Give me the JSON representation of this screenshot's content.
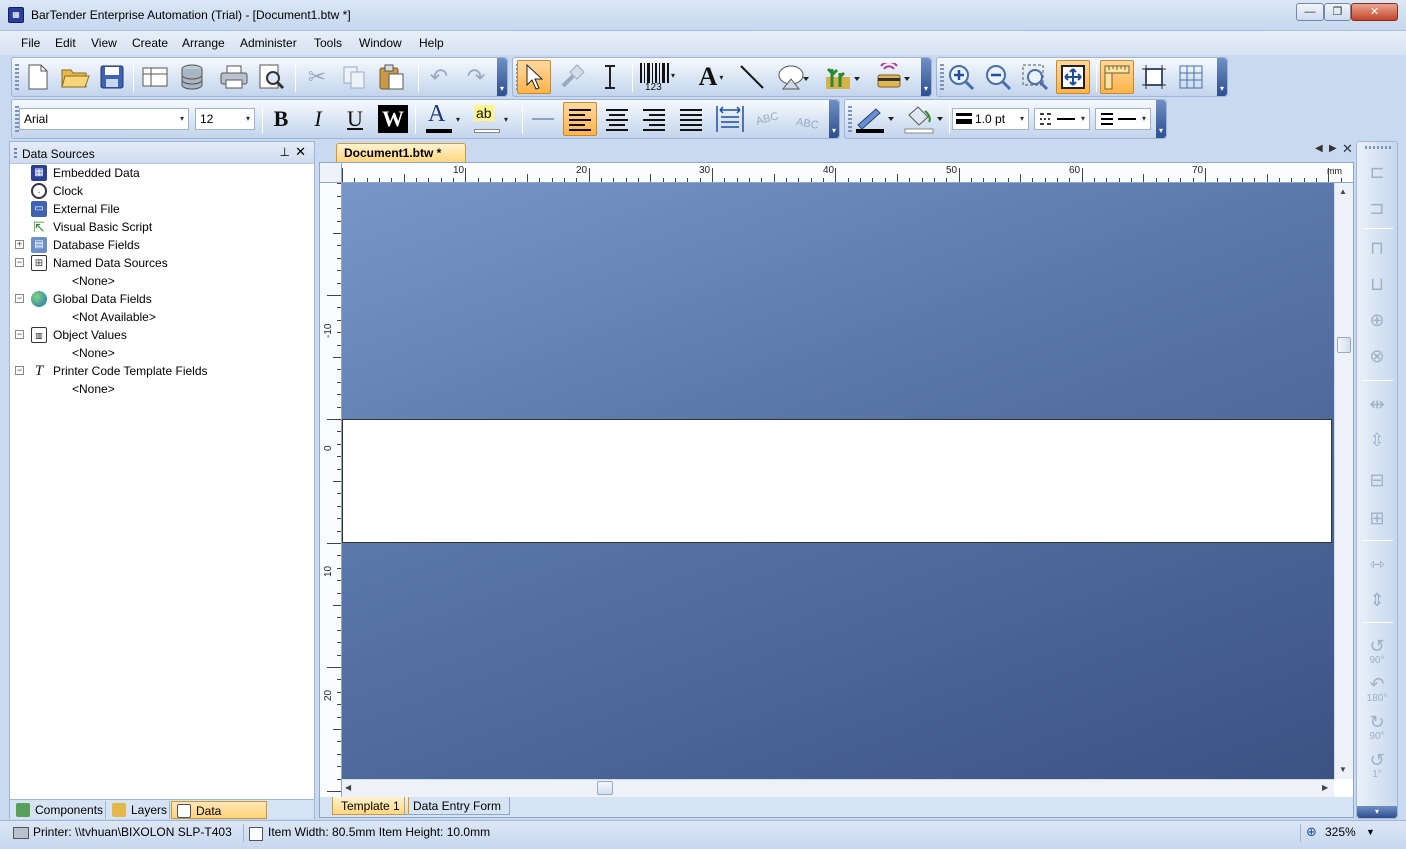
{
  "window": {
    "title": "BarTender Enterprise Automation (Trial) - [Document1.btw *]",
    "min_glyph": "—",
    "max_glyph": "❐",
    "close_glyph": "✕"
  },
  "menu": [
    "File",
    "Edit",
    "View",
    "Create",
    "Arrange",
    "Administer",
    "Tools",
    "Window",
    "Help"
  ],
  "format_toolbar": {
    "font_name": "Arial",
    "font_size": "12",
    "bold": "B",
    "italic": "I",
    "underline": "U",
    "reverse": "W",
    "font_color": "A",
    "highlight": "ab",
    "rotate_abc_1": "ABC",
    "rotate_abc_2": "ABC",
    "line_thickness": "1.0 pt"
  },
  "toolbar_icons": {
    "text_tool": "A",
    "barcode_numbers": "123"
  },
  "data_sources_panel": {
    "title": "Data Sources",
    "pin_glyph": "📌",
    "close_glyph": "✕",
    "items": [
      {
        "label": "Embedded Data",
        "icon": "embedded-data-icon",
        "expander": ""
      },
      {
        "label": "Clock",
        "icon": "clock-icon",
        "expander": ""
      },
      {
        "label": "External File",
        "icon": "floppy-disk-icon",
        "expander": ""
      },
      {
        "label": "Visual Basic Script",
        "icon": "script-icon",
        "expander": ""
      },
      {
        "label": "Database Fields",
        "icon": "database-fields-icon",
        "expander": "+"
      },
      {
        "label": "Named Data Sources",
        "icon": "named-data-sources-icon",
        "expander": "−"
      },
      {
        "label": "Global Data Fields",
        "icon": "globe-icon",
        "expander": "−"
      },
      {
        "label": "Object Values",
        "icon": "object-values-icon",
        "expander": "−"
      },
      {
        "label": "Printer Code Template Fields",
        "icon": "template-fields-icon",
        "expander": "−"
      }
    ],
    "children": {
      "named": "<None>",
      "global": "<Not Available>",
      "object_values": "<None>",
      "printer_code": "<None>"
    },
    "tabs": [
      "Components",
      "Layers",
      "Data Sources"
    ]
  },
  "document": {
    "tab_label": "Document1.btw *",
    "ruler_unit": "mm",
    "ruler_h_numbers": [
      "10",
      "20",
      "30",
      "40",
      "50",
      "60",
      "70"
    ],
    "ruler_v_numbers": [
      "-10",
      "0",
      "10",
      "20"
    ],
    "sheet_tabs": [
      "Template 1",
      "Data Entry Form"
    ]
  },
  "right_toolbar": {
    "rotate_90_left": "90°",
    "rotate_180": "180°",
    "rotate_90_right": "90°",
    "rotate_1": "1°"
  },
  "status": {
    "printer": "Printer: \\\\tvhuan\\BIXOLON SLP-T403",
    "item_size": "Item Width: 80.5mm  Item Height: 10.0mm",
    "zoom": "325%"
  },
  "colors": {
    "accent_active": "#ffb347",
    "canvas_top": "#7897c7",
    "canvas_bottom": "#3b5283"
  }
}
